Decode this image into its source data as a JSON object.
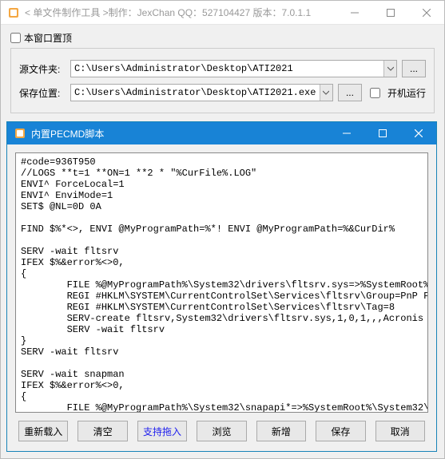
{
  "main": {
    "title": "< 单文件制作工具 >制作：JexChan  QQ：527104427  版本：7.0.1.1",
    "checkbox_topmost": "本窗口置顶",
    "label_source": "源文件夹:",
    "value_source": "C:\\Users\\Administrator\\Desktop\\ATI2021",
    "label_save": "保存位置:",
    "value_save": "C:\\Users\\Administrator\\Desktop\\ATI2021.exe",
    "checkbox_autostart": "开机运行",
    "dots": "..."
  },
  "inner": {
    "title": "内置PECMD脚本",
    "code": "#code=936T950\n//LOGS **t=1 **ON=1 **2 * \"%CurFile%.LOG\"\nENVI^ ForceLocal=1\nENVI^ EnviMode=1\nSET$ @NL=0D 0A\n\nFIND $%*<>, ENVI @MyProgramPath=%*! ENVI @MyProgramPath=%&CurDir%\n\nSERV -wait fltsrv\nIFEX $%&error%<>0,\n{\n        FILE %@MyProgramPath%\\System32\\drivers\\fltsrv.sys=>%SystemRoot%\\System32\\drivers\\fltsrv.sys\n        REGI #HKLM\\SYSTEM\\CurrentControlSet\\Services\\fltsrv\\Group=PnP Filter\n        REGI #HKLM\\SYSTEM\\CurrentControlSet\\Services\\fltsrv\\Tag=8\n        SERV-create fltsrv,System32\\drivers\\fltsrv.sys,1,0,1,,,Acronis Storage Filter Management\n        SERV -wait fltsrv\n}\nSERV -wait fltsrv\n\nSERV -wait snapman\nIFEX $%&error%<>0,\n{\n        FILE %@MyProgramPath%\\System32\\snapapi*=>%SystemRoot%\\System32\\\n        FILE %@MyProgramPath%\\System32\\drivers\\snapman.sys=>%SystemRoot%\\System32\\drivers\\snapman.sys",
    "buttons": {
      "reload": "重新载入",
      "clear": "清空",
      "drag": "支持拖入",
      "browse": "浏览",
      "new": "新增",
      "save": "保存",
      "cancel": "取消"
    }
  }
}
